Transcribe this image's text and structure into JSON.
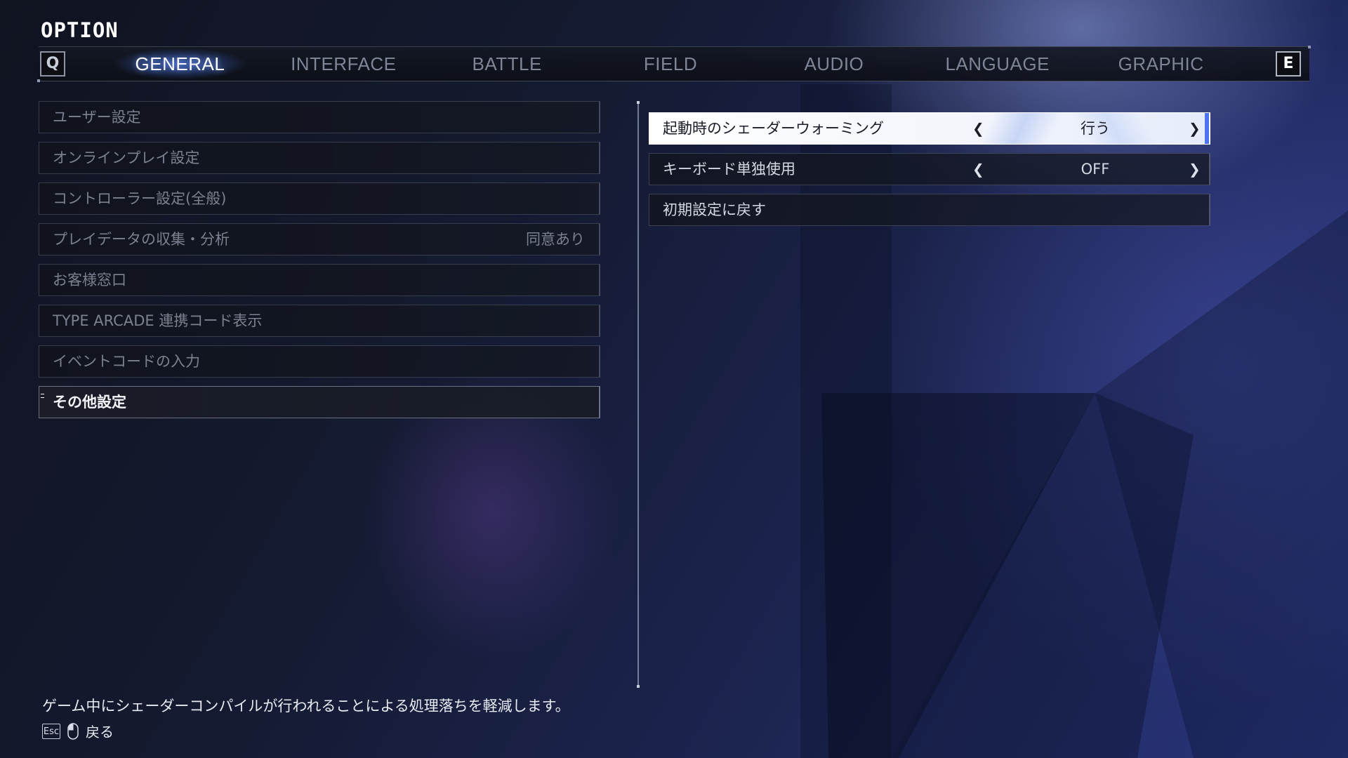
{
  "header": {
    "title": "OPTION"
  },
  "tabbar": {
    "prev_key": "Q",
    "next_key": "E",
    "tabs": [
      {
        "label": "GENERAL",
        "active": true
      },
      {
        "label": "INTERFACE",
        "active": false
      },
      {
        "label": "BATTLE",
        "active": false
      },
      {
        "label": "FIELD",
        "active": false
      },
      {
        "label": "AUDIO",
        "active": false
      },
      {
        "label": "LANGUAGE",
        "active": false
      },
      {
        "label": "GRAPHIC",
        "active": false
      }
    ]
  },
  "left_menu": {
    "items": [
      {
        "label": "ユーザー設定",
        "value": ""
      },
      {
        "label": "オンラインプレイ設定",
        "value": ""
      },
      {
        "label": "コントローラー設定(全般)",
        "value": ""
      },
      {
        "label": "プレイデータの収集・分析",
        "value": "同意あり"
      },
      {
        "label": "お客様窓口",
        "value": ""
      },
      {
        "label": "TYPE ARCADE 連携コード表示",
        "value": ""
      },
      {
        "label": "イベントコードの入力",
        "value": ""
      },
      {
        "label": "その他設定",
        "value": "",
        "selected": true
      }
    ]
  },
  "right_settings": {
    "items": [
      {
        "label": "起動時のシェーダーウォーミング",
        "value": "行う",
        "highlight": true
      },
      {
        "label": "キーボード単独使用",
        "value": "OFF"
      },
      {
        "label": "初期設定に戻す",
        "value": ""
      }
    ]
  },
  "footer": {
    "description": "ゲーム中にシェーダーコンパイルが行われることによる処理落ちを軽減します。",
    "esc_key": "Esc",
    "back_label": "戻る"
  },
  "colors": {
    "accent": "#4d74f0",
    "highlight_bg": "#ffffff",
    "text_dim": "#7b8190"
  }
}
